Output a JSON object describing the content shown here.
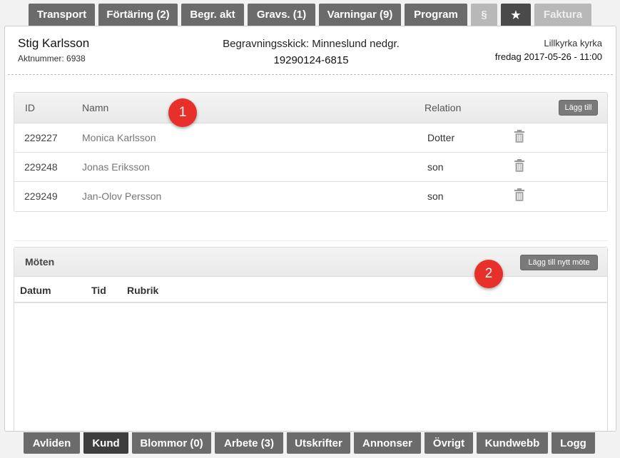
{
  "top_tabs": {
    "transport": "Transport",
    "fortaring": "Förtäring (2)",
    "begr_akt": "Begr. akt",
    "gravs": "Gravs. (1)",
    "varningar": "Varningar (9)",
    "program": "Program",
    "paragraph": "§",
    "star": "★",
    "faktura": "Faktura"
  },
  "header": {
    "name": "Stig Karlsson",
    "aktnummer": "Aktnummer: 6938",
    "begravningsskick": "Begravningsskick: Minneslund nedgr.",
    "personnummer": "19290124-6815",
    "kyrka": "Lillkyrka kyrka",
    "datetime": "fredag 2017-05-26 - 11:00"
  },
  "relatives": {
    "columns": {
      "id": "ID",
      "namn": "Namn",
      "relation": "Relation"
    },
    "add_label": "Lägg till",
    "rows": [
      {
        "id": "229227",
        "namn": "Monica Karlsson",
        "relation": "Dotter"
      },
      {
        "id": "229248",
        "namn": "Jonas Eriksson",
        "relation": "son"
      },
      {
        "id": "229249",
        "namn": "Jan-Olov Persson",
        "relation": "son"
      }
    ]
  },
  "meetings": {
    "title": "Möten",
    "add_label": "Lägg till nytt möte",
    "columns": {
      "datum": "Datum",
      "tid": "Tid",
      "rubrik": "Rubrik"
    }
  },
  "badges": {
    "one": "1",
    "two": "2"
  },
  "bottom_tabs": {
    "avliden": "Avliden",
    "kund": "Kund",
    "blommor": "Blommor (0)",
    "arbete": "Arbete (3)",
    "utskrifter": "Utskrifter",
    "annonser": "Annonser",
    "ovrigt": "Övrigt",
    "kundwebb": "Kundwebb",
    "logg": "Logg"
  },
  "colors": {
    "tab": "#6b6b6b",
    "tab_active": "#3e3e3e",
    "badge": "#e8302b"
  }
}
